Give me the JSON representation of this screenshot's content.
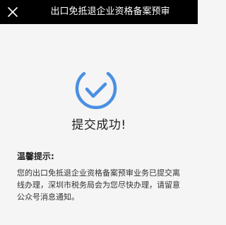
{
  "header": {
    "close_icon": "close-icon",
    "title": "出口免抵退企业资格备案预审"
  },
  "result": {
    "icon": "success-check-icon",
    "accent_color": "#4a90e2",
    "status_text": "提交成功!"
  },
  "tips": {
    "title": "温馨提示:",
    "body": "您的出口免抵退企业资格备案预审业务已提交离线办理，深圳市税务局会为您尽快办理，请留意公众号消息通知。"
  }
}
